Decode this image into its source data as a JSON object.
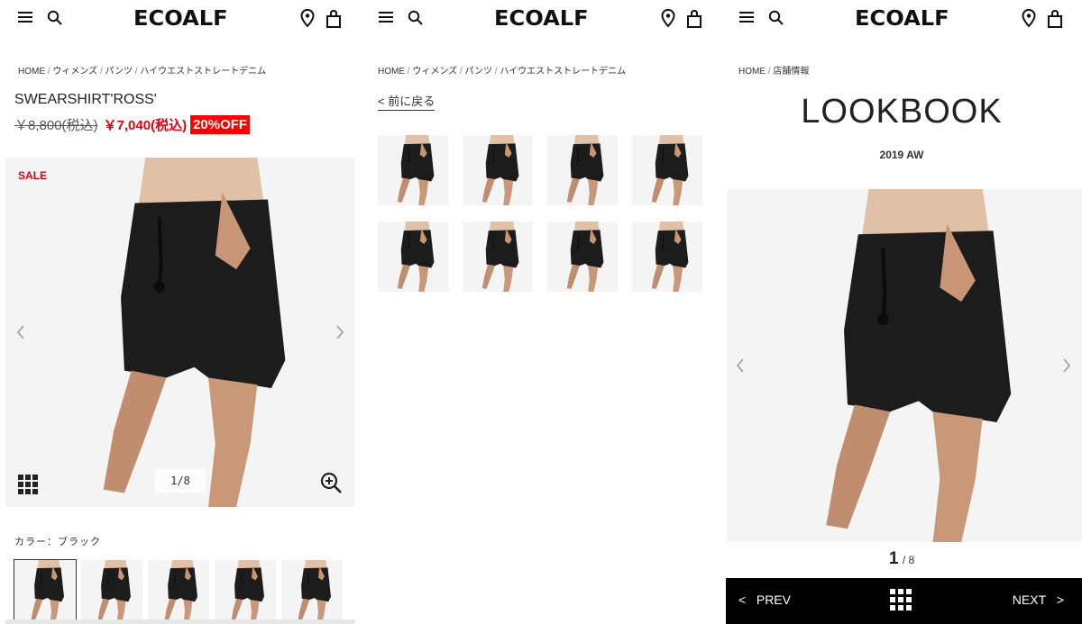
{
  "brand": {
    "logo_text": "ECOALF"
  },
  "panel1": {
    "breadcrumb": [
      "HOME",
      "ウィメンズ",
      "パンツ",
      "ハイウエストストレートデニム"
    ],
    "product_title": "SWEARSHIRT'ROSS'",
    "price_old": "￥8,800(税込)",
    "price_new": "￥7,040(税込)",
    "discount_badge": "20%OFF",
    "sale_label": "SALE",
    "image_counter": "1/8",
    "color_label": "カラー：ブラック"
  },
  "panel2": {
    "breadcrumb": [
      "HOME",
      "ウィメンズ",
      "パンツ",
      "ハイウエストストレートデニム"
    ],
    "back_link": "< 前に戻る"
  },
  "panel3": {
    "breadcrumb": [
      "HOME",
      "店舗情報"
    ],
    "title": "LOOKBOOK",
    "season": "2019 AW",
    "page_current": "1",
    "page_total": "/ 8",
    "prev_label": "PREV",
    "next_label": "NEXT"
  },
  "colors": {
    "accent_red": "#e60012",
    "badge_red": "#ff0000",
    "nav_bg": "#000000"
  },
  "icons": [
    "menu-icon",
    "search-icon",
    "store-pin-icon",
    "bag-icon",
    "grid-icon",
    "zoom-in-icon",
    "chevron-left-icon",
    "chevron-right-icon"
  ]
}
